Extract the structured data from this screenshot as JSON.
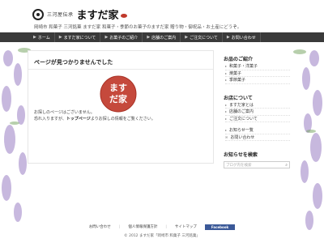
{
  "header": {
    "logo_sub": "三河屋伝承",
    "logo_main": "ますだ家",
    "tagline": "岡崎市 和菓子 三河銘菓 ますだ家 和菓子・季節のお菓子のますだ家 贈り物・御祝品・お土産にどうぞ。"
  },
  "nav": {
    "items": [
      {
        "icon": "▶",
        "label": "ホーム"
      },
      {
        "icon": "▶",
        "label": "ますだ家について"
      },
      {
        "icon": "▶",
        "label": "お菓子のご紹介"
      },
      {
        "icon": "▶",
        "label": "店舗のご案内"
      },
      {
        "icon": "▶",
        "label": "ご注文について"
      },
      {
        "icon": "▶",
        "label": "お問い合わせ"
      }
    ]
  },
  "main": {
    "title": "ページが見つかりませんでした",
    "stamp_text": "ますだ家",
    "message_line1": "お探しのページはございません。",
    "message_line2_prefix": "恐れ入りますが、",
    "message_line2_link": "トップページ",
    "message_line2_suffix": "よりお探しの情報をご覧ください。"
  },
  "sidebar": {
    "section1_title": "お品のご紹介",
    "section1_items": [
      "和菓子・洋菓子",
      "焼菓子",
      "季節菓子"
    ],
    "section2_title": "お店について",
    "section2_items": [
      "ますだ家とは",
      "店舗のご案内",
      "ご注文について"
    ],
    "section3_items": [
      "お知らせ一覧",
      "お問い合わせ"
    ],
    "search_title": "お知らせを検索",
    "search_placeholder": "ブログ内を検索"
  },
  "footer": {
    "link1": "お問い合わせ",
    "link2": "個人情報保護方針",
    "link3": "サイトマップ",
    "facebook": "Facebook",
    "copyright": "© 2012 ますだ家「岡崎市 和菓子 三河銘菓」"
  },
  "colors": {
    "nav_bg": "#3a3a3a",
    "stamp_red": "#c0392b",
    "wisteria": "#8e6fb0"
  }
}
